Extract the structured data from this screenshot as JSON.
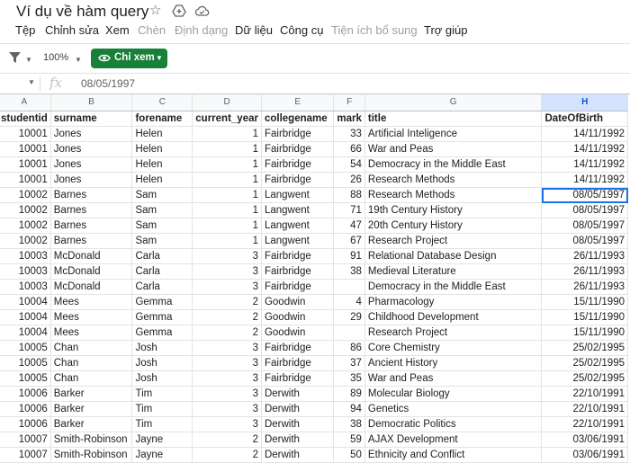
{
  "app": {
    "title": "Ví dụ về hàm query",
    "icons": [
      "star-icon",
      "move-to-drive-icon",
      "cloud-status-icon"
    ]
  },
  "menu": [
    "Tệp",
    "Chỉnh sửa",
    "Xem",
    "Chèn",
    "Định dạng",
    "Dữ liệu",
    "Công cụ",
    "Tiện ích bổ sung",
    "Trợ giúp"
  ],
  "menu_dimmed": [
    false,
    false,
    false,
    true,
    true,
    false,
    false,
    true,
    false
  ],
  "toolbar": {
    "zoom": "100%",
    "view_mode_label": "Chỉ xem"
  },
  "formula_bar": {
    "fx_label": "fx",
    "value": "08/05/1997"
  },
  "colors": {
    "view_button": "#188038",
    "selection": "#1a73e8"
  },
  "sheet": {
    "column_letters": [
      "A",
      "B",
      "C",
      "D",
      "E",
      "F",
      "G",
      "H"
    ],
    "selected_column": "H",
    "headers": [
      "studentid",
      "surname",
      "forename",
      "current_year",
      "collegename",
      "mark",
      "title",
      "DateOfBirth"
    ],
    "rows": [
      [
        "10001",
        "Jones",
        "Helen",
        "1",
        "Fairbridge",
        "33",
        "Artificial Inteligence",
        "14/11/1992"
      ],
      [
        "10001",
        "Jones",
        "Helen",
        "1",
        "Fairbridge",
        "66",
        "War and Peas",
        "14/11/1992"
      ],
      [
        "10001",
        "Jones",
        "Helen",
        "1",
        "Fairbridge",
        "54",
        "Democracy in the Middle East",
        "14/11/1992"
      ],
      [
        "10001",
        "Jones",
        "Helen",
        "1",
        "Fairbridge",
        "26",
        "Research Methods",
        "14/11/1992"
      ],
      [
        "10002",
        "Barnes",
        "Sam",
        "1",
        "Langwent",
        "88",
        "Research Methods",
        "08/05/1997"
      ],
      [
        "10002",
        "Barnes",
        "Sam",
        "1",
        "Langwent",
        "71",
        "19th Century History",
        "08/05/1997"
      ],
      [
        "10002",
        "Barnes",
        "Sam",
        "1",
        "Langwent",
        "47",
        "20th Century History",
        "08/05/1997"
      ],
      [
        "10002",
        "Barnes",
        "Sam",
        "1",
        "Langwent",
        "67",
        "Research Project",
        "08/05/1997"
      ],
      [
        "10003",
        "McDonald",
        "Carla",
        "3",
        "Fairbridge",
        "91",
        "Relational Database Design",
        "26/11/1993"
      ],
      [
        "10003",
        "McDonald",
        "Carla",
        "3",
        "Fairbridge",
        "38",
        "Medieval Literature",
        "26/11/1993"
      ],
      [
        "10003",
        "McDonald",
        "Carla",
        "3",
        "Fairbridge",
        "",
        "Democracy in the Middle East",
        "26/11/1993"
      ],
      [
        "10004",
        "Mees",
        "Gemma",
        "2",
        "Goodwin",
        "4",
        "Pharmacology",
        "15/11/1990"
      ],
      [
        "10004",
        "Mees",
        "Gemma",
        "2",
        "Goodwin",
        "29",
        "Childhood Development",
        "15/11/1990"
      ],
      [
        "10004",
        "Mees",
        "Gemma",
        "2",
        "Goodwin",
        "",
        "Research Project",
        "15/11/1990"
      ],
      [
        "10005",
        "Chan",
        "Josh",
        "3",
        "Fairbridge",
        "86",
        "Core Chemistry",
        "25/02/1995"
      ],
      [
        "10005",
        "Chan",
        "Josh",
        "3",
        "Fairbridge",
        "37",
        "Ancient History",
        "25/02/1995"
      ],
      [
        "10005",
        "Chan",
        "Josh",
        "3",
        "Fairbridge",
        "35",
        "War and Peas",
        "25/02/1995"
      ],
      [
        "10006",
        "Barker",
        "Tim",
        "3",
        "Derwith",
        "89",
        "Molecular Biology",
        "22/10/1991"
      ],
      [
        "10006",
        "Barker",
        "Tim",
        "3",
        "Derwith",
        "94",
        "Genetics",
        "22/10/1991"
      ],
      [
        "10006",
        "Barker",
        "Tim",
        "3",
        "Derwith",
        "38",
        "Democratic Politics",
        "22/10/1991"
      ],
      [
        "10007",
        "Smith-Robinson",
        "Jayne",
        "2",
        "Derwith",
        "59",
        "AJAX Development",
        "03/06/1991"
      ],
      [
        "10007",
        "Smith-Robinson",
        "Jayne",
        "2",
        "Derwith",
        "50",
        "Ethnicity and Conflict",
        "03/06/1991"
      ]
    ],
    "selected_cell": {
      "row": 4,
      "col": 7
    }
  }
}
